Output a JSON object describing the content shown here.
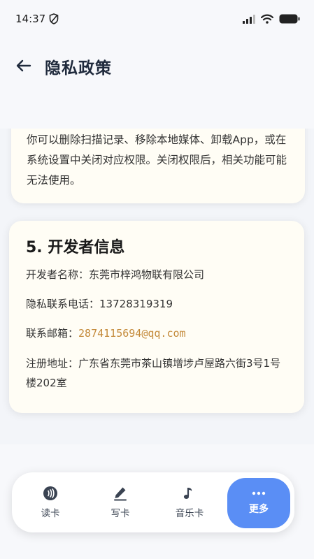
{
  "status_bar": {
    "time": "14:37"
  },
  "header": {
    "title": "隐私政策"
  },
  "previous_section": {
    "text": "你可以删除扫描记录、移除本地媒体、卸载App，或在系统设置中关闭对应权限。关闭权限后，相关功能可能无法使用。"
  },
  "developer_section": {
    "heading": "5. 开发者信息",
    "name_label": "开发者名称：",
    "name_value": "东莞市梓鸿物联有限公司",
    "phone_label": "隐私联系电话：",
    "phone_value": "13728319319",
    "email_label": "联系邮箱：",
    "email_value": "2874115694@qq.com",
    "address_label": "注册地址：",
    "address_value": "广东省东莞市茶山镇增埗卢屋路六街3号1号楼202室"
  },
  "bottom_nav": {
    "items": [
      {
        "label": "读卡",
        "icon": "nfc-read-icon"
      },
      {
        "label": "写卡",
        "icon": "pencil-write-icon"
      },
      {
        "label": "音乐卡",
        "icon": "music-note-icon"
      },
      {
        "label": "更多",
        "icon": "more-dots-icon",
        "active": true
      }
    ]
  },
  "colors": {
    "accent": "#5a8ef5",
    "link": "#c48a3a",
    "card": "#fffdf5"
  }
}
